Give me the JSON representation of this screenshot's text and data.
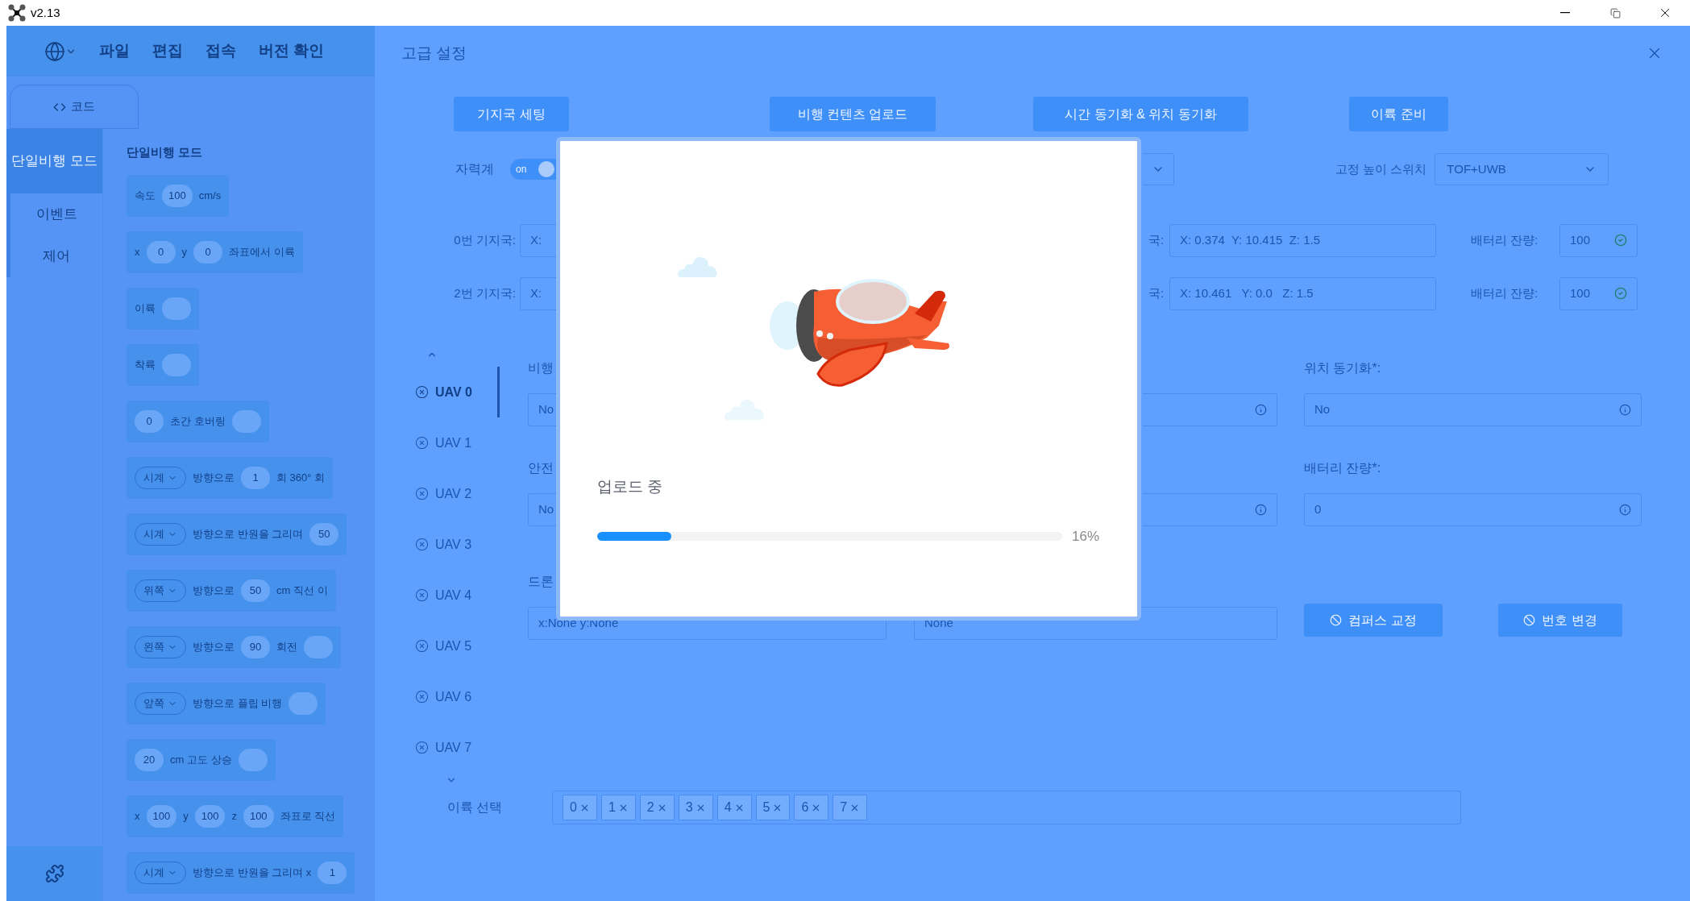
{
  "title_bar": {
    "title": "v2.13"
  },
  "menu_bar": {
    "items": [
      "파일",
      "편집",
      "접속",
      "버전 확인"
    ]
  },
  "code_tab": {
    "label": "코드"
  },
  "categories": [
    {
      "label": "단일비행 모드",
      "selected": true
    },
    {
      "label": "이벤트",
      "selected": false
    },
    {
      "label": "제어",
      "selected": false
    }
  ],
  "workspace": {
    "heading": "단일비행 모드",
    "blocks": [
      {
        "parts": [
          {
            "kind": "text",
            "text": "속도"
          },
          {
            "kind": "input",
            "text": "100"
          },
          {
            "kind": "text",
            "text": "cm/s"
          }
        ]
      },
      {
        "parts": [
          {
            "kind": "text",
            "text": "x"
          },
          {
            "kind": "input",
            "text": "0"
          },
          {
            "kind": "text",
            "text": "y"
          },
          {
            "kind": "input",
            "text": "0"
          },
          {
            "kind": "text",
            "text": "좌표에서 이륙"
          }
        ]
      },
      {
        "parts": [
          {
            "kind": "text",
            "text": "이륙"
          },
          {
            "kind": "input"
          }
        ]
      },
      {
        "parts": [
          {
            "kind": "text",
            "text": "착륙"
          },
          {
            "kind": "input"
          }
        ]
      },
      {
        "parts": [
          {
            "kind": "input",
            "text": "0"
          },
          {
            "kind": "text",
            "text": "초간 호버링"
          },
          {
            "kind": "input"
          }
        ]
      },
      {
        "parts": [
          {
            "kind": "dropdown",
            "text": "시계"
          },
          {
            "kind": "text",
            "text": "방향으로"
          },
          {
            "kind": "input",
            "text": "1"
          },
          {
            "kind": "text",
            "text": "회 360° 회"
          }
        ]
      },
      {
        "parts": [
          {
            "kind": "dropdown",
            "text": "시계"
          },
          {
            "kind": "text",
            "text": "방향으로 반원을 그리며"
          },
          {
            "kind": "input",
            "text": "50"
          }
        ]
      },
      {
        "parts": [
          {
            "kind": "dropdown",
            "text": "위쪽"
          },
          {
            "kind": "text",
            "text": "방향으로"
          },
          {
            "kind": "input",
            "text": "50"
          },
          {
            "kind": "text",
            "text": "cm 직선 이"
          }
        ]
      },
      {
        "parts": [
          {
            "kind": "dropdown",
            "text": "왼쪽"
          },
          {
            "kind": "text",
            "text": "방향으로"
          },
          {
            "kind": "input",
            "text": "90"
          },
          {
            "kind": "text",
            "text": "회전"
          },
          {
            "kind": "input"
          }
        ]
      },
      {
        "parts": [
          {
            "kind": "dropdown",
            "text": "앞쪽"
          },
          {
            "kind": "text",
            "text": "방향으로 플립 비행"
          },
          {
            "kind": "input"
          }
        ]
      },
      {
        "parts": [
          {
            "kind": "input",
            "text": "20"
          },
          {
            "kind": "text",
            "text": "cm 고도 상승"
          },
          {
            "kind": "input"
          }
        ]
      },
      {
        "parts": [
          {
            "kind": "text",
            "text": "x"
          },
          {
            "kind": "input",
            "text": "100"
          },
          {
            "kind": "text",
            "text": "y"
          },
          {
            "kind": "input",
            "text": "100"
          },
          {
            "kind": "text",
            "text": "z"
          },
          {
            "kind": "input",
            "text": "100"
          },
          {
            "kind": "text",
            "text": "좌표로 직선"
          }
        ]
      },
      {
        "parts": [
          {
            "kind": "dropdown",
            "text": "시계"
          },
          {
            "kind": "text",
            "text": "방향으로 반원을 그리며 x"
          },
          {
            "kind": "input",
            "text": "1"
          }
        ]
      }
    ]
  },
  "settings_dialog": {
    "title": "고급 설정",
    "buttons": [
      "기지국 세팅",
      "비행 컨텐츠 업로드",
      "시간 동기화 & 위치 동기화",
      "이륙 준비"
    ],
    "magnetometer": {
      "label": "자력계",
      "toggle_text": "on",
      "on": true
    },
    "fixed_height_switch": {
      "label": "고정 높이 스위치",
      "value": "TOF+UWB"
    },
    "base_stations": [
      {
        "label": "0번 기지국:",
        "left_value": "X:",
        "right_label": "국:",
        "right_value": "X: 0.374  Y: 10.415  Z: 1.5",
        "battery_label": "배터리 잔량:",
        "battery": "100"
      },
      {
        "label": "2번 기지국:",
        "left_value": "X:",
        "right_label": "국:",
        "right_value": "X: 10.461   Y: 0.0   Z: 1.5",
        "battery_label": "배터리 잔량:",
        "battery": "100"
      }
    ],
    "uav_tabs": [
      {
        "label": "UAV 0",
        "selected": true
      },
      {
        "label": "UAV 1",
        "selected": false
      },
      {
        "label": "UAV 2",
        "selected": false
      },
      {
        "label": "UAV 3",
        "selected": false
      },
      {
        "label": "UAV 4",
        "selected": false
      },
      {
        "label": "UAV 5",
        "selected": false
      },
      {
        "label": "UAV 6",
        "selected": false
      },
      {
        "label": "UAV 7",
        "selected": false
      }
    ],
    "form_rows": [
      {
        "kind": "fields",
        "label": "비행",
        "value": "No",
        "right_label": "위치 동기화*:",
        "right_value": "No"
      },
      {
        "kind": "fields",
        "label": "안전",
        "value": "No",
        "right_label": "배터리 잔량*:",
        "right_value": "0"
      },
      {
        "kind": "actions",
        "label": "드론",
        "value": "x:None y:None",
        "middle_value": "None",
        "buttons": [
          "컴퍼스 교정",
          "번호 변경"
        ]
      }
    ],
    "takeoff_select": {
      "label": "이륙 선택",
      "tags": [
        "0",
        "1",
        "2",
        "3",
        "4",
        "5",
        "6",
        "7"
      ]
    }
  },
  "upload_modal": {
    "status": "업로드 중",
    "level": 0.16,
    "percent": "16%"
  }
}
